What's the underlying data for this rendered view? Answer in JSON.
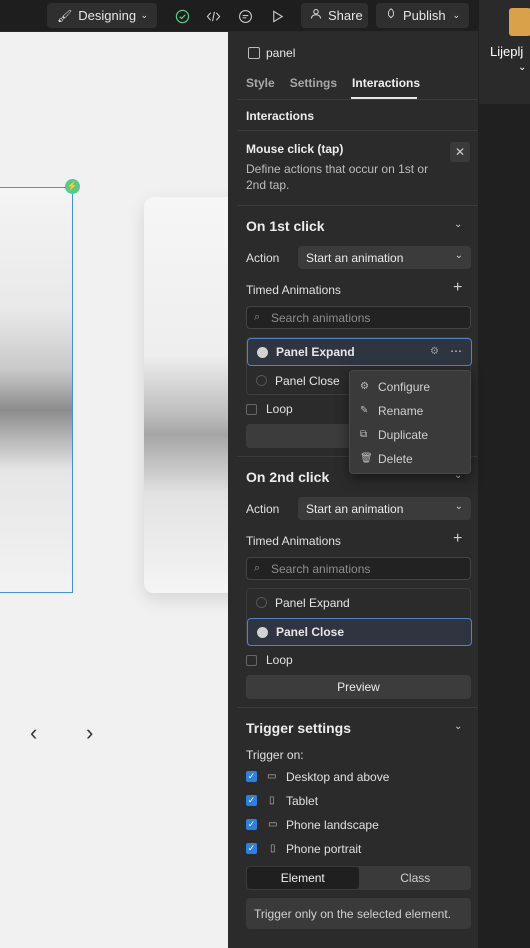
{
  "topbar": {
    "mode_label": "Designing",
    "share_label": "Share",
    "publish_label": "Publish"
  },
  "desktop": {
    "folder_label": "Lijeplj"
  },
  "panel": {
    "element_name": "panel",
    "tabs": [
      {
        "label": "Style"
      },
      {
        "label": "Settings"
      },
      {
        "label": "Interactions"
      }
    ],
    "section_title": "Interactions",
    "trigger": {
      "title": "Mouse click (tap)",
      "description_line1": "Define actions that occur on 1st or",
      "description_line2": "2nd tap."
    },
    "first_click": {
      "title": "On 1st click",
      "action_label": "Action",
      "action_value": "Start an animation",
      "timed_label": "Timed Animations",
      "search_placeholder": "Search animations",
      "items": [
        {
          "label": "Panel Expand",
          "selected": true
        },
        {
          "label": "Panel Close",
          "selected": false
        }
      ],
      "loop_label": "Loop",
      "preview_label": "Pr"
    },
    "second_click": {
      "title": "On 2nd click",
      "action_label": "Action",
      "action_value": "Start an animation",
      "timed_label": "Timed Animations",
      "search_placeholder": "Search animations",
      "items": [
        {
          "label": "Panel Expand",
          "selected": false
        },
        {
          "label": "Panel Close",
          "selected": true
        }
      ],
      "loop_label": "Loop",
      "preview_label": "Preview"
    },
    "trigger_settings": {
      "title": "Trigger settings",
      "trigger_on_label": "Trigger on:",
      "devices": [
        {
          "label": "Desktop and above",
          "checked": true
        },
        {
          "label": "Tablet",
          "checked": true
        },
        {
          "label": "Phone landscape",
          "checked": true
        },
        {
          "label": "Phone portrait",
          "checked": true
        }
      ],
      "scope_options": [
        "Element",
        "Class"
      ],
      "scope_selected": "Element",
      "note": "Trigger only on the selected element."
    }
  },
  "context_menu": {
    "items": [
      {
        "label": "Configure",
        "icon": "gear-icon"
      },
      {
        "label": "Rename",
        "icon": "pencil-icon"
      },
      {
        "label": "Duplicate",
        "icon": "duplicate-icon"
      },
      {
        "label": "Delete",
        "icon": "trash-icon"
      }
    ]
  },
  "colors": {
    "accent": "#2f7fe0",
    "selection_outline": "#4a90e2",
    "interaction_badge": "#59c98a"
  }
}
